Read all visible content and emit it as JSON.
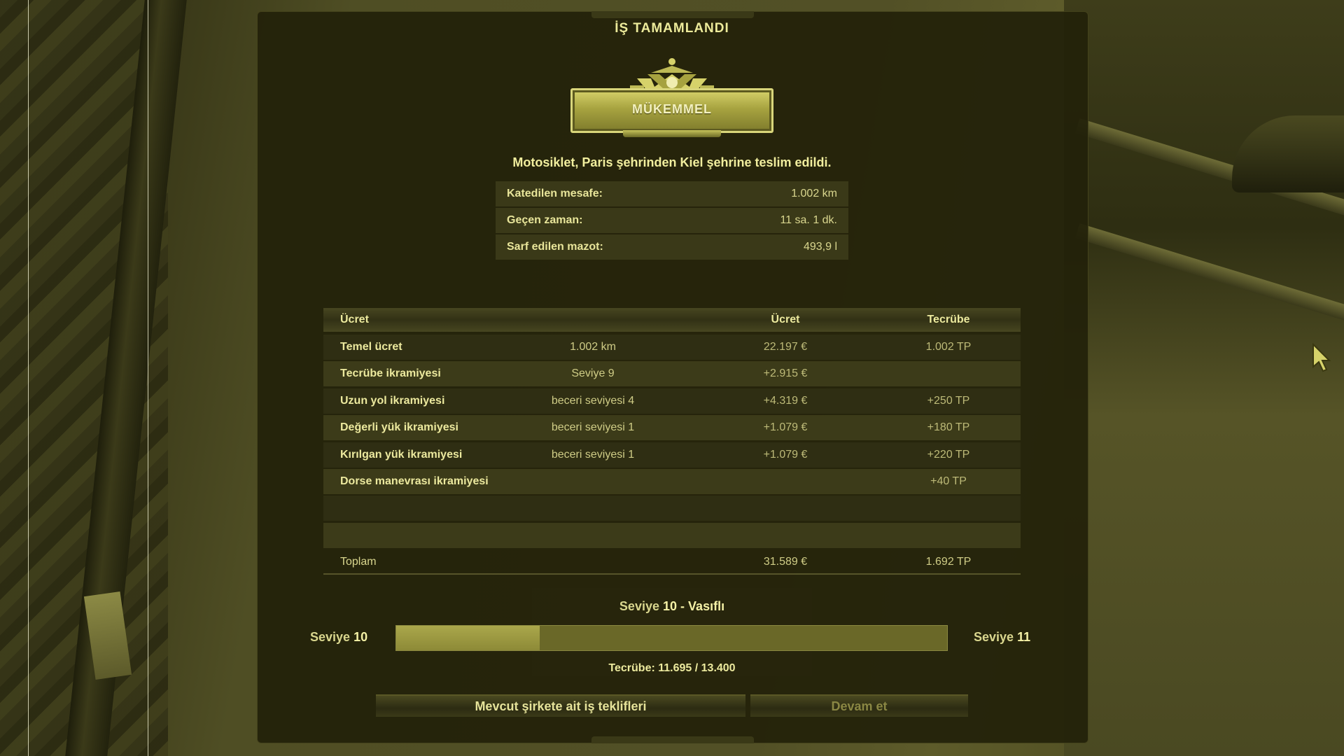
{
  "window": {
    "title": "İŞ TAMAMLANDI"
  },
  "rating": {
    "label": "MÜKEMMEL",
    "icon": "crown-emblem-icon"
  },
  "delivery_message": "Motosiklet, Paris şehrinden Kiel şehrine teslim edildi.",
  "stats": [
    {
      "label": "Katedilen mesafe:",
      "value": "1.002 km"
    },
    {
      "label": "Geçen zaman:",
      "value": "11 sa. 1 dk."
    },
    {
      "label": "Sarf edilen mazot:",
      "value": "493,9 l"
    }
  ],
  "income_table": {
    "headers": {
      "name": "Ücret",
      "money": "Ücret",
      "xp": "Tecrübe"
    },
    "rows": [
      {
        "name": "Temel ücret",
        "detail": "1.002 km",
        "money": "22.197 €",
        "xp": "1.002 TP"
      },
      {
        "name": "Tecrübe ikramiyesi",
        "detail": "Seviye 9",
        "money": "+2.915 €",
        "xp": ""
      },
      {
        "name": "Uzun yol ikramiyesi",
        "detail": "beceri seviyesi 4",
        "money": "+4.319 €",
        "xp": "+250 TP"
      },
      {
        "name": "Değerli yük ikramiyesi",
        "detail": "beceri seviyesi 1",
        "money": "+1.079 €",
        "xp": "+180 TP"
      },
      {
        "name": "Kırılgan yük ikramiyesi",
        "detail": "beceri seviyesi 1",
        "money": "+1.079 €",
        "xp": "+220 TP"
      },
      {
        "name": "Dorse manevrası ikramiyesi",
        "detail": "",
        "money": "",
        "xp": "+40 TP"
      },
      {
        "name": "",
        "detail": "",
        "money": "",
        "xp": ""
      },
      {
        "name": "",
        "detail": "",
        "money": "",
        "xp": ""
      }
    ],
    "total": {
      "name": "Toplam",
      "money": "31.589 €",
      "xp": "1.692 TP"
    }
  },
  "level": {
    "title_prefix": "Seviye",
    "current_level": "10",
    "title_suffix": "- Vasıflı",
    "left_label": "Seviye",
    "left_value": "10",
    "right_label": "Seviye",
    "right_value": "11",
    "progress_fraction_before": 0.26,
    "progress_fraction_after": 0.0,
    "experience_text": "Tecrübe: 11.695 / 13.400"
  },
  "buttons": {
    "offers": "Mevcut şirkete ait iş teklifleri",
    "continue": "Devam et"
  },
  "colors": {
    "tint": "#e6e39a",
    "panel_bg": "#22210a",
    "progress_fill": "#aaa74b",
    "progress_track": "#6a6828"
  }
}
